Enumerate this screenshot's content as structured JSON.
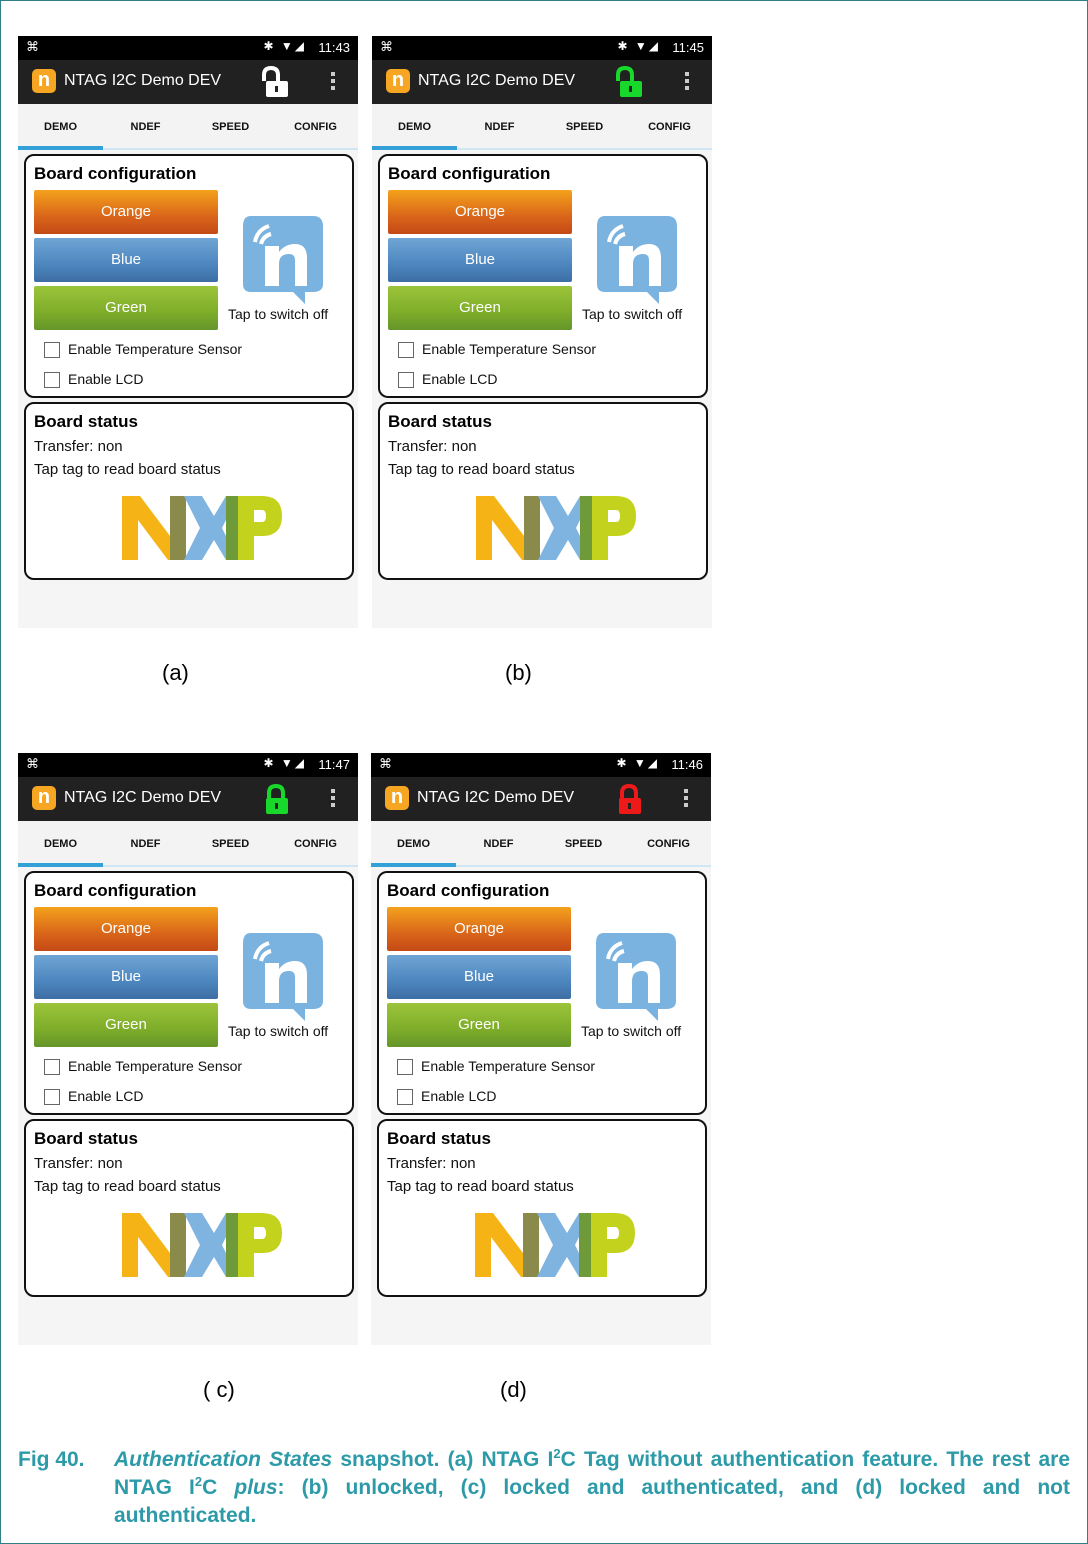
{
  "screens": [
    {
      "time": "11:43",
      "lock_state": "unlocked",
      "lock_color": "#ffffff",
      "sublabel": "(a)"
    },
    {
      "time": "11:45",
      "lock_state": "unlocked",
      "lock_color": "#17d82b",
      "sublabel": "(b)"
    },
    {
      "time": "11:47",
      "lock_state": "locked",
      "lock_color": "#17d82b",
      "sublabel": "( c)"
    },
    {
      "time": "11:46",
      "lock_state": "locked",
      "lock_color": "#ee1a1a",
      "sublabel": "(d)"
    }
  ],
  "app": {
    "title": "NTAG I2C Demo DEV",
    "logo_letter": "n",
    "tabs": [
      "DEMO",
      "NDEF",
      "SPEED",
      "CONFIG"
    ],
    "board_config_title": "Board configuration",
    "buttons": {
      "orange": "Orange",
      "blue": "Blue",
      "green": "Green"
    },
    "tap_to_switch": "Tap to switch off",
    "checkboxes": [
      "Enable Temperature Sensor",
      "Enable LCD"
    ],
    "board_status_title": "Board status",
    "transfer": "Transfer: non",
    "tap_tag": "Tap tag to read board status",
    "status_icons": "✱ ▼◢"
  },
  "colors": {
    "tab_indicator": "#33a0d8",
    "caption": "#2d9aa8",
    "nxp_yellow": "#f5b316",
    "nxp_blue": "#7fb4e0",
    "nxp_green": "#c3d21c"
  },
  "caption": {
    "fig_number": "Fig 40.",
    "title_italic": "Authentication States",
    "part1": " snapshot. (a) NTAG I",
    "sup1": "2",
    "part2": "C Tag without authentication feature. The rest are NTAG I",
    "sup2": "2",
    "part3": "C ",
    "italic2": "plus",
    "part4": ": (b) unlocked, (c) locked and authenticated, and (d) locked and not authenticated."
  }
}
